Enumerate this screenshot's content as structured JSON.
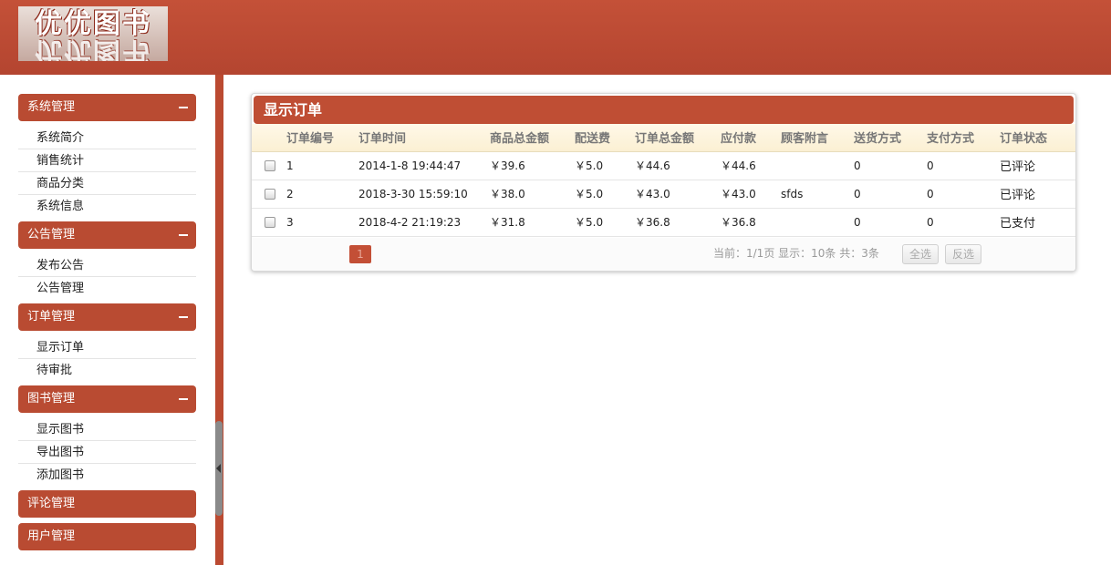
{
  "header": {
    "logo_text": "优优图书"
  },
  "sidebar": {
    "groups": [
      {
        "title": "系统管理",
        "items": [
          "系统简介",
          "销售统计",
          "商品分类",
          "系统信息"
        ]
      },
      {
        "title": "公告管理",
        "items": [
          "发布公告",
          "公告管理"
        ]
      },
      {
        "title": "订单管理",
        "items": [
          "显示订单",
          "待审批"
        ]
      },
      {
        "title": "图书管理",
        "items": [
          "显示图书",
          "导出图书",
          "添加图书"
        ]
      },
      {
        "title": "评论管理",
        "items": []
      },
      {
        "title": "用户管理",
        "items": []
      }
    ]
  },
  "panel": {
    "title": "显示订单",
    "columns": [
      "订单编号",
      "订单时间",
      "商品总金额",
      "配送费",
      "订单总金额",
      "应付款",
      "顾客附言",
      "送货方式",
      "支付方式",
      "订单状态"
    ],
    "rows": [
      [
        "1",
        "2014-1-8 19:44:47",
        "￥39.6",
        "￥5.0",
        "￥44.6",
        "￥44.6",
        "",
        "0",
        "0",
        "已评论"
      ],
      [
        "2",
        "2018-3-30 15:59:10",
        "￥38.0",
        "￥5.0",
        "￥43.0",
        "￥43.0",
        "sfds",
        "0",
        "0",
        "已评论"
      ],
      [
        "3",
        "2018-4-2 21:19:23",
        "￥31.8",
        "￥5.0",
        "￥36.8",
        "￥36.8",
        "",
        "0",
        "0",
        "已支付"
      ]
    ],
    "pager": {
      "current_page": "1",
      "info": "当前：1/1页 显示：10条 共：3条",
      "select_all_label": "全选",
      "invert_label": "反选"
    }
  },
  "colors": {
    "brand": "#bf4e34",
    "header": "#c45138"
  }
}
